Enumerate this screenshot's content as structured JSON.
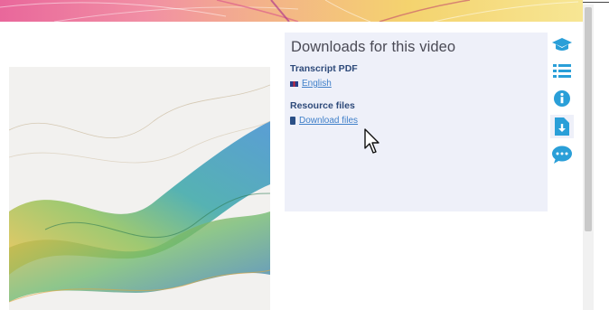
{
  "panel": {
    "title": "Downloads for this video",
    "transcript_heading": "Transcript PDF",
    "transcript_link": "English",
    "resource_heading": "Resource files",
    "resource_link": "Download files"
  },
  "side_icons": [
    {
      "name": "graduation-cap-icon"
    },
    {
      "name": "list-icon"
    },
    {
      "name": "info-icon"
    },
    {
      "name": "file-download-icon",
      "active": true
    },
    {
      "name": "chat-bubble-icon"
    }
  ],
  "colors": {
    "accent": "#2a9fd8",
    "panel_bg": "#eef0f9",
    "heading": "#2e4a7a",
    "link": "#3f7fc9"
  }
}
